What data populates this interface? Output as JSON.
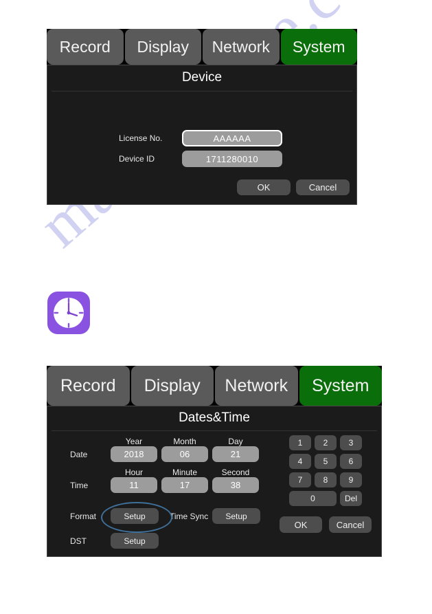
{
  "watermark": {
    "text": "manualshive.com"
  },
  "tabs": {
    "items": [
      {
        "label": "Record",
        "active": false
      },
      {
        "label": "Display",
        "active": false
      },
      {
        "label": "Network",
        "active": false
      },
      {
        "label": "System",
        "active": true
      }
    ],
    "active_color": "#0a6e0a",
    "inactive_color": "#5a5a5a"
  },
  "device_screen": {
    "title": "Device",
    "tabs": [
      "Record",
      "Display",
      "Network",
      "System"
    ],
    "fields": [
      {
        "label": "License No.",
        "value": "AAAAAA",
        "focused": true
      },
      {
        "label": "Device ID",
        "value": "1711280010",
        "focused": false
      }
    ],
    "buttons": {
      "ok": "OK",
      "cancel": "Cancel"
    }
  },
  "clock_icon": {
    "name": "clock-icon",
    "background": "#8a52e0",
    "face": "#ffffff",
    "hour_hand_deg": 0,
    "minute_hand_deg": 75
  },
  "datetime_screen": {
    "title": "Dates&Time",
    "tabs": [
      "Record",
      "Display",
      "Network",
      "System"
    ],
    "date_row": {
      "label": "Date",
      "columns": [
        "Year",
        "Month",
        "Day"
      ],
      "values": [
        "2018",
        "06",
        "21"
      ]
    },
    "time_row": {
      "label": "Time",
      "columns": [
        "Hour",
        "Minute",
        "Second"
      ],
      "values": [
        "11",
        "17",
        "38"
      ]
    },
    "format_row": {
      "label": "Format",
      "button": "Setup",
      "highlighted": true,
      "highlight_color": "#3f7099"
    },
    "time_sync_row": {
      "label": "Time Sync",
      "button": "Setup"
    },
    "dst_row": {
      "label": "DST",
      "button": "Setup"
    },
    "keypad": {
      "keys": [
        "1",
        "2",
        "3",
        "4",
        "5",
        "6",
        "7",
        "8",
        "9"
      ],
      "zero": "0",
      "delete": "Del"
    },
    "buttons": {
      "ok": "OK",
      "cancel": "Cancel"
    }
  }
}
